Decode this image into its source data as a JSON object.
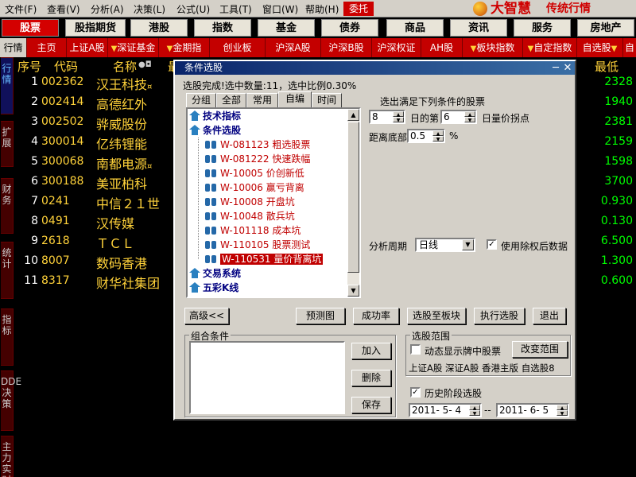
{
  "menubar": {
    "items": [
      "文件(F)",
      "查看(V)",
      "分析(A)",
      "决策(L)",
      "公式(U)",
      "工具(T)",
      "窗口(W)",
      "帮助(H)"
    ],
    "weituo": "委托",
    "logo_main": "大智慧",
    "logo_sub": "传统行情"
  },
  "categories": [
    "股票",
    "股指期货",
    "港股",
    "指数",
    "基金",
    "债券",
    "商品",
    "资讯",
    "服务",
    "房地产"
  ],
  "subtabs": [
    "行情",
    "主页",
    "上证A股",
    "深证基金",
    "金期指",
    "创业板",
    "沪深A股",
    "沪深B股",
    "沪深权证",
    "AH股",
    "板块指数",
    "自定指数",
    "自选股",
    "自"
  ],
  "sidetabs": [
    "行情",
    "扩展",
    "财务",
    "统计",
    "指标",
    "DDE决策",
    "主力实时"
  ],
  "table": {
    "headers": [
      "序号",
      "代码",
      "名称",
      "最",
      "最低"
    ],
    "name_marks": "●◘",
    "rows": [
      {
        "seq": "1",
        "code": "002362",
        "name": "汉王科技",
        "mark": "¤",
        "price": "2328"
      },
      {
        "seq": "2",
        "code": "002414",
        "name": "高德红外",
        "mark": "",
        "price": "1940"
      },
      {
        "seq": "3",
        "code": "002502",
        "name": "骅威股份",
        "mark": "",
        "price": "2381"
      },
      {
        "seq": "4",
        "code": "300014",
        "name": "亿纬锂能",
        "mark": "",
        "price": "2159"
      },
      {
        "seq": "5",
        "code": "300068",
        "name": "南都电源",
        "mark": "¤",
        "price": "1598"
      },
      {
        "seq": "6",
        "code": "300188",
        "name": "美亚柏科",
        "mark": "",
        "price": "3700"
      },
      {
        "seq": "7",
        "code": "0241",
        "name": "中信２１世",
        "mark": "",
        "price": "0.930"
      },
      {
        "seq": "8",
        "code": "0491",
        "name": "汉传媒",
        "mark": "",
        "price": "0.130"
      },
      {
        "seq": "9",
        "code": "2618",
        "name": "ＴＣＬ",
        "mark": "",
        "price": "6.500"
      },
      {
        "seq": "10",
        "code": "8007",
        "name": "数码香港",
        "mark": "",
        "price": "1.300"
      },
      {
        "seq": "11",
        "code": "8317",
        "name": "财华社集团",
        "mark": "",
        "price": "0.600"
      }
    ]
  },
  "dialog": {
    "title": "条件选股",
    "status": "选股完成!选中数量:11，选中比例0.30%",
    "tabs": [
      "分组",
      "全部",
      "常用",
      "自编",
      "时间"
    ],
    "active_tab": "自编",
    "tree": [
      {
        "label": "技术指标",
        "type": "hdr"
      },
      {
        "label": "条件选股",
        "type": "hdr"
      },
      {
        "label": "W-081123 粗选股票",
        "type": "item"
      },
      {
        "label": "W-081222 快速跌幅",
        "type": "item"
      },
      {
        "label": "W-10005 价创新低",
        "type": "item"
      },
      {
        "label": "W-10006 赢亏背离",
        "type": "item"
      },
      {
        "label": "W-10008 开盘坑",
        "type": "item"
      },
      {
        "label": "W-10048 散兵坑",
        "type": "item"
      },
      {
        "label": "W-101118 成本坑",
        "type": "item"
      },
      {
        "label": "W-110105 股票测试",
        "type": "item"
      },
      {
        "label": "W-110531 量价背离坑",
        "type": "item",
        "selected": true
      },
      {
        "label": "交易系统",
        "type": "hdr"
      },
      {
        "label": "五彩K线",
        "type": "hdr"
      }
    ],
    "cond_title": "选出满足下列条件的股票",
    "param1": "8",
    "param1_label": "日的第",
    "param2": "6",
    "param2_label": "日量价拐点",
    "dist_label": "距离底部",
    "dist_value": "0.5",
    "dist_unit": "%",
    "period_label": "分析周期",
    "period_value": "日线",
    "use_adjusted_label": "使用除权后数据",
    "use_adjusted_checked": "✓",
    "buttons": {
      "advanced": "高级<<",
      "preview": "预测图",
      "success_rate": "成功率",
      "to_sector": "选股至板块",
      "execute": "执行选股",
      "exit": "退出"
    },
    "combo_group": "组合条件",
    "combo_buttons": {
      "add": "加入",
      "delete": "删除",
      "save": "保存"
    },
    "range_group": "选股范围",
    "dynamic_label": "动态显示牌中股票",
    "change_range": "改变范围",
    "range_text": "上证A股 深证A股 香港主版 自选股8",
    "history_label": "历史阶段选股",
    "history_checked": "✓",
    "date_from": "2011- 5- 4",
    "date_sep": "--",
    "date_to": "2011- 6- 5"
  }
}
